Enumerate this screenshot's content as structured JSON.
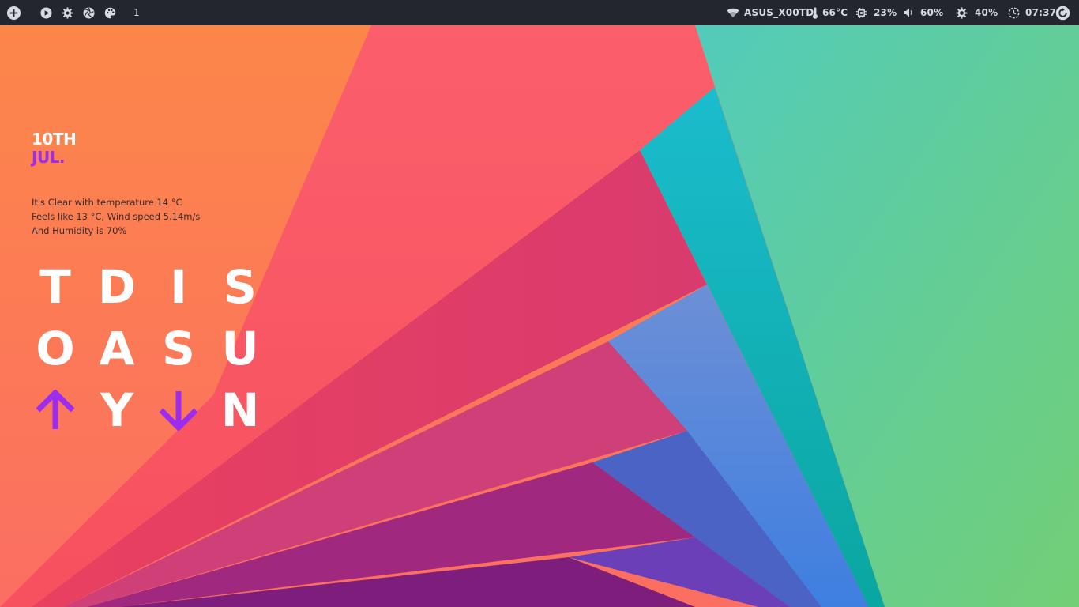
{
  "topbar": {
    "workspace": "1",
    "wifi": {
      "icon": "wifi-icon",
      "label": "ASUS_X00TD"
    },
    "temp": {
      "icon": "thermometer-icon",
      "label": "66°C"
    },
    "cpu": {
      "icon": "cpu-icon",
      "label": "23%"
    },
    "volume": {
      "icon": "volume-icon",
      "label": "60%"
    },
    "brightness": {
      "icon": "brightness-icon",
      "label": "40%"
    },
    "clock": {
      "icon": "clock-icon",
      "label": "07:37"
    }
  },
  "widget": {
    "day": "10TH",
    "month": "JUL.",
    "weather_lines": [
      "It's Clear with temperature 14 °C",
      "Feels like 13 °C, Wind speed 5.14m/s",
      "And Humidity is 70%"
    ],
    "grid": [
      [
        "T",
        "D",
        "I",
        "S"
      ],
      [
        "O",
        "A",
        "S",
        "U"
      ],
      [
        "↑",
        "Y",
        "↓",
        "N"
      ]
    ]
  },
  "colors": {
    "bar": "#23262e",
    "bar_text": "#d8dae0",
    "accent": "#9b2cf0",
    "widget_text": "#ffffff"
  }
}
